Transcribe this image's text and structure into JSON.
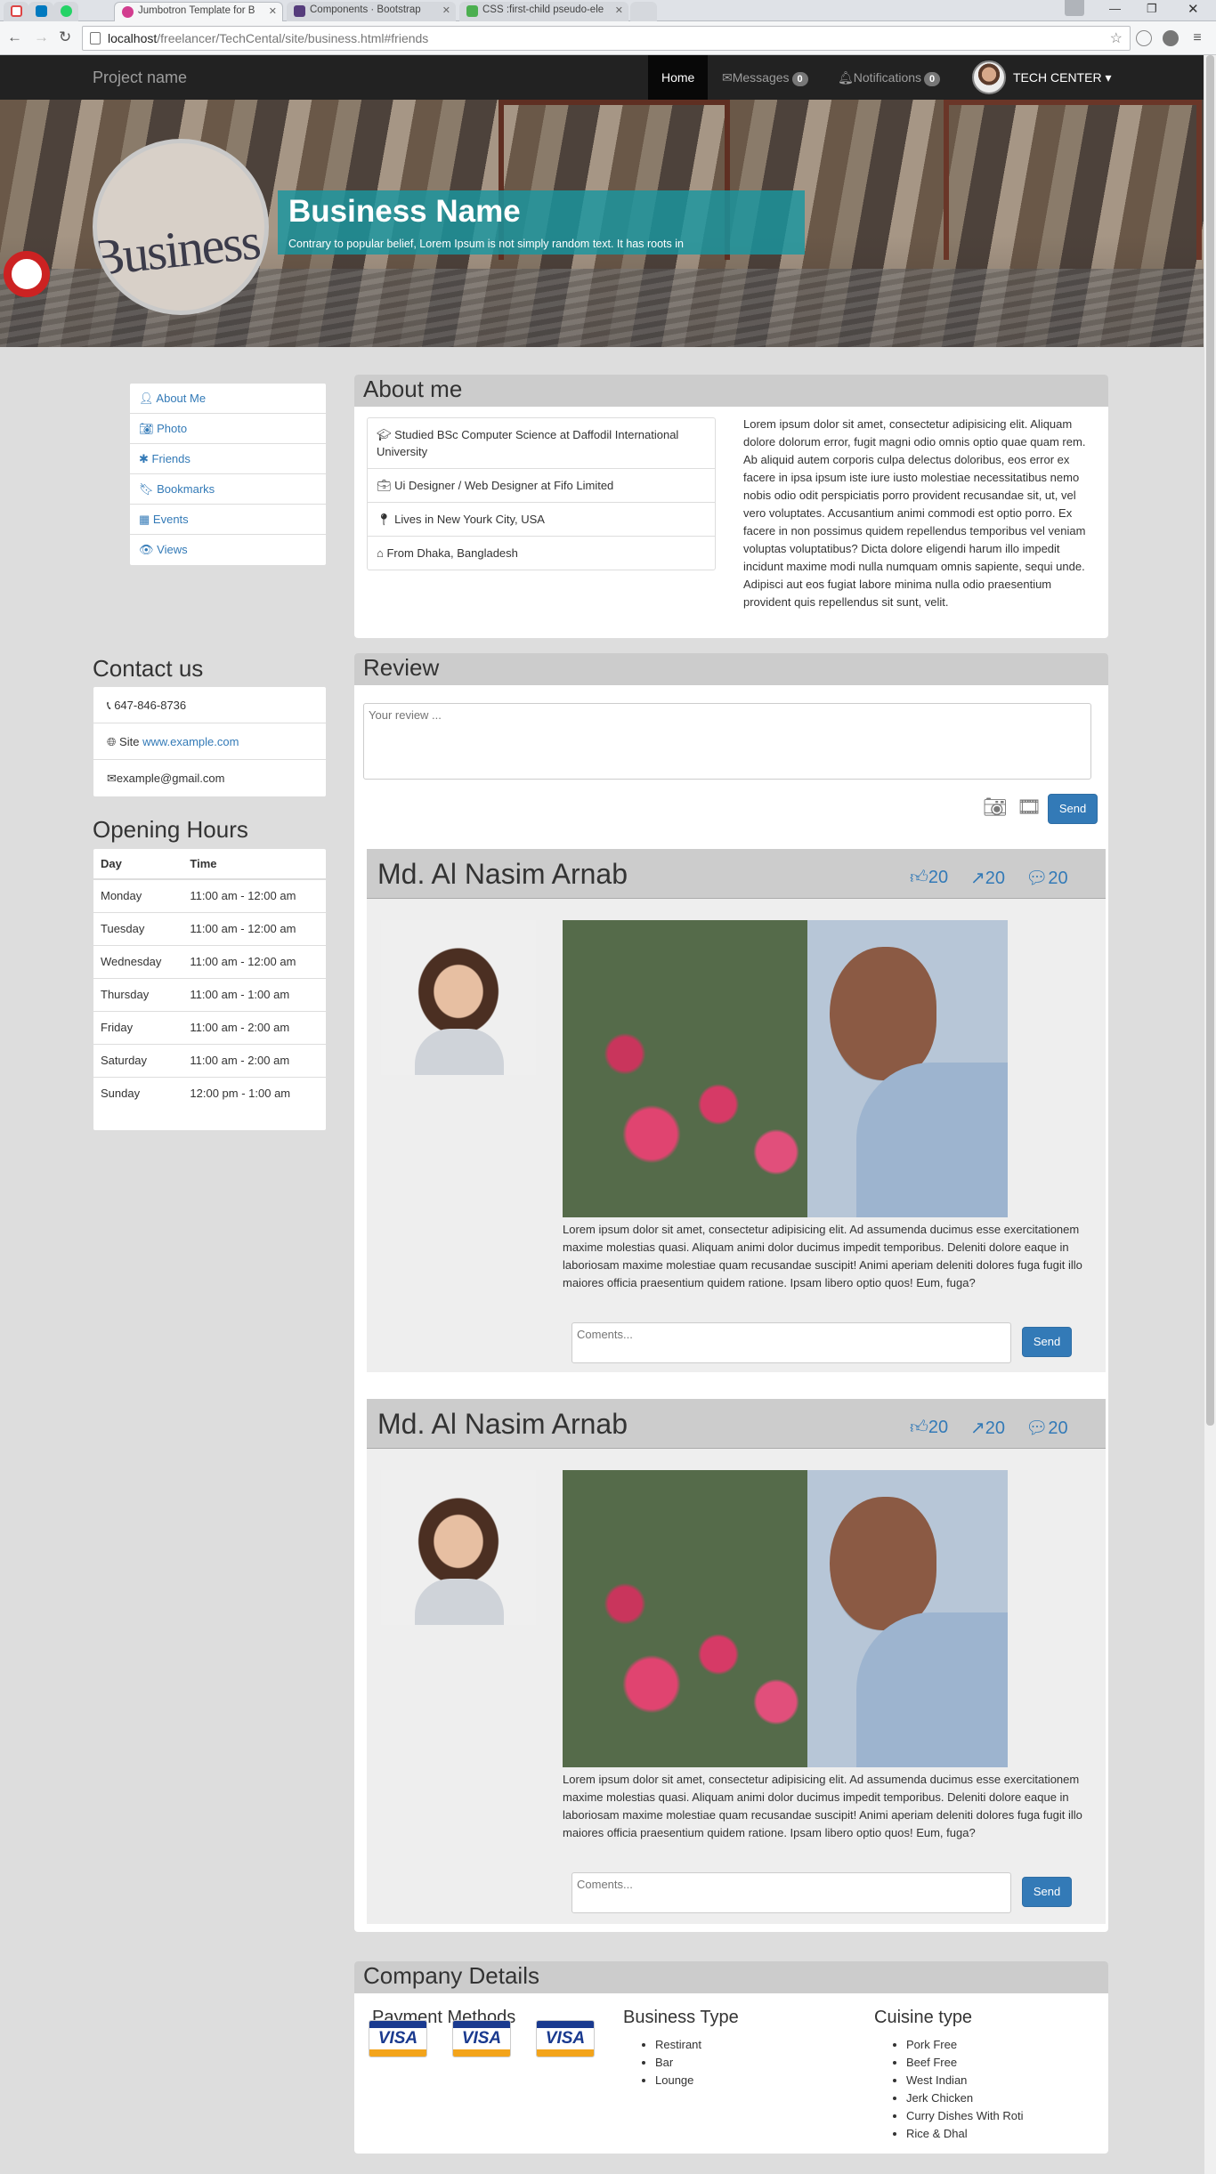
{
  "browser": {
    "tabs": [
      {
        "label": "",
        "icon": "gmail-icon"
      },
      {
        "label": "",
        "icon": "trello-icon"
      },
      {
        "label": "",
        "icon": "whatsapp-icon"
      },
      {
        "label": "Jumbotron Template for B",
        "icon": "bootstrap-icon",
        "active": true
      },
      {
        "label": "Components · Bootstrap",
        "icon": "bootstrap-icon"
      },
      {
        "label": "CSS :first-child pseudo-ele",
        "icon": "w3-icon"
      }
    ],
    "url_host": "localhost",
    "url_path": "/freelancer/TechCental/site/business.html#friends"
  },
  "navbar": {
    "brand": "Project name",
    "home": "Home",
    "messages": "Messages",
    "messages_count": "0",
    "notifications": "Notifications",
    "notifications_count": "0",
    "user": "TECH CENTER"
  },
  "banner": {
    "logo_word": "Business",
    "title": "Business Name",
    "subtitle": "Contrary to popular belief, Lorem Ipsum is not simply random text. It has roots in"
  },
  "sidebar": {
    "items": [
      "About Me",
      "Photo",
      "Friends",
      "Bookmarks",
      "Events",
      "Views"
    ]
  },
  "contact": {
    "heading": "Contact us",
    "phone": "647-846-8736",
    "site_label": "Site",
    "site_url": "www.example.com",
    "email": "example@gmail.com"
  },
  "hours": {
    "heading": "Opening Hours",
    "col_day": "Day",
    "col_time": "Time",
    "rows": [
      {
        "day": "Monday",
        "time": "11:00 am - 12:00 am"
      },
      {
        "day": "Tuesday",
        "time": "11:00 am - 12:00 am"
      },
      {
        "day": "Wednesday",
        "time": "11:00 am - 12:00 am"
      },
      {
        "day": "Thursday",
        "time": "11:00 am - 1:00 am"
      },
      {
        "day": "Friday",
        "time": "11:00 am - 2:00 am"
      },
      {
        "day": "Saturday",
        "time": "11:00 am - 2:00 am"
      },
      {
        "day": "Sunday",
        "time": "12:00 pm - 1:00 am"
      }
    ]
  },
  "about": {
    "heading": "About me",
    "items": [
      "Studied BSc Computer Science at Daffodil International University",
      "Ui Designer / Web Designer at Fifo Limited",
      "Lives in New Yourk City, USA",
      "From Dhaka, Bangladesh"
    ],
    "text": "Lorem ipsum dolor sit amet, consectetur adipisicing elit. Aliquam dolore dolorum error, fugit magni odio omnis optio quae quam rem. Ab aliquid autem corporis culpa delectus doloribus, eos error ex facere in ipsa ipsum iste iure iusto molestiae necessitatibus nemo nobis odio odit perspiciatis porro provident recusandae sit, ut, vel vero voluptates. Accusantium animi commodi est optio porro. Ex facere in non possimus quidem repellendus temporibus vel veniam voluptas voluptatibus? Dicta dolore eligendi harum illo impedit incidunt maxime modi nulla numquam omnis sapiente, sequi unde. Adipisci aut eos fugiat labore minima nulla odio praesentium provident quis repellendus sit sunt, velit."
  },
  "review": {
    "heading": "Review",
    "placeholder": "Your review ...",
    "send": "Send",
    "posts": [
      {
        "name": "Md. Al Nasim Arnab",
        "likes": "20",
        "shares": "20",
        "comments": "20",
        "text": "Lorem ipsum dolor sit amet, consectetur adipisicing elit. Ad assumenda ducimus esse exercitationem maxime molestias quasi. Aliquam animi dolor ducimus impedit temporibus. Deleniti dolore eaque in laboriosam maxime molestiae quam recusandae suscipit! Animi aperiam deleniti dolores fuga fugit illo maiores officia praesentium quidem ratione. Ipsam libero optio quos! Eum, fuga?",
        "comment_placeholder": "Coments...",
        "send": "Send"
      },
      {
        "name": "Md. Al Nasim Arnab",
        "likes": "20",
        "shares": "20",
        "comments": "20",
        "text": "Lorem ipsum dolor sit amet, consectetur adipisicing elit. Ad assumenda ducimus esse exercitationem maxime molestias quasi. Aliquam animi dolor ducimus impedit temporibus. Deleniti dolore eaque in laboriosam maxime molestiae quam recusandae suscipit! Animi aperiam deleniti dolores fuga fugit illo maiores officia praesentium quidem ratione. Ipsam libero optio quos! Eum, fuga?",
        "comment_placeholder": "Coments...",
        "send": "Send"
      }
    ]
  },
  "company": {
    "heading": "Company Details",
    "payment_heading": "Payment Methods",
    "card_label": "VISA",
    "business_heading": "Business Type",
    "business_types": [
      "Restirant",
      "Bar",
      "Lounge"
    ],
    "cuisine_heading": "Cuisine type",
    "cuisines": [
      "Pork Free",
      "Beef Free",
      "West Indian",
      "Jerk Chicken",
      "Curry Dishes With Roti",
      "Rice & Dhal"
    ]
  },
  "colors": {
    "link": "#337ab7",
    "navbar": "#222222",
    "title_box": "#1896a0",
    "panel_heading": "#cccccc"
  }
}
